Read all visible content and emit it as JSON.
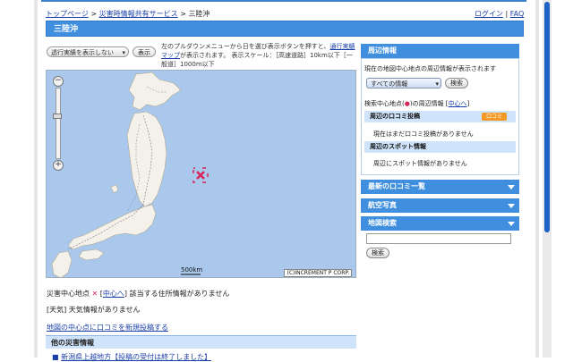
{
  "breadcrumb": {
    "home": "トップページ",
    "service": "災害時情報共有サービス",
    "current": "三陸沖",
    "sep1": ">",
    "sep2": ">"
  },
  "toplinks": {
    "login": "ログイン",
    "sep": "|",
    "faq": "FAQ"
  },
  "page_title": "三陸沖",
  "controls": {
    "overlay_select": "透行実績を表示しない",
    "show_button": "表示",
    "help_text_1": "左のプルダウンメニューから日を選び表示ボタンを押すと、",
    "help_link": "通行実績マップ",
    "help_text_2": "が表示されます。 表示スケール：［高速道路］10km以下［一般道］1000m以下"
  },
  "map": {
    "scale_label": "500km",
    "copyright": "(C)INCREMENT P CORP.",
    "zoom_in": "+",
    "zoom_out": "−",
    "marker_icon": "disaster-center-icon",
    "colors": {
      "sea": "#a9c8ec",
      "land": "#f3f1ea",
      "marker": "#d6285a"
    }
  },
  "info": {
    "center_label": "災害中心地点",
    "center_link": "中心へ",
    "no_address": "該当する住所情報がありません",
    "weather_label": "[天気]",
    "weather_text": "天気情報がありません",
    "post_link": "地図の中心点に口コミを新規投稿する"
  },
  "other": {
    "title": "他の災害情報",
    "item": "新潟県上越地方【投稿の受付は終了しました】"
  },
  "sidebar": {
    "nearby_title": "周辺情報",
    "nearby_desc": "現在の地図中心地点の周辺情報が表示されます",
    "filter_select": "すべての情報",
    "search_button": "検索",
    "search_center_prefix": "検索中心地点(",
    "search_center_suffix": ")の周辺情報 [",
    "center_link": "中心へ",
    "close_bracket": "]",
    "reviews_title": "周辺の口コミ投稿",
    "rss_badge": "口コミRSS",
    "reviews_empty": "現在はまだ口コミ投稿がありません",
    "spots_title": "周辺のスポット情報",
    "spots_empty": "周辺にスポット情報がありません",
    "latest_reviews": "最新の口コミ一覧",
    "aerial": "航空写真",
    "map_search": "地図検索",
    "map_search_button": "検索"
  }
}
